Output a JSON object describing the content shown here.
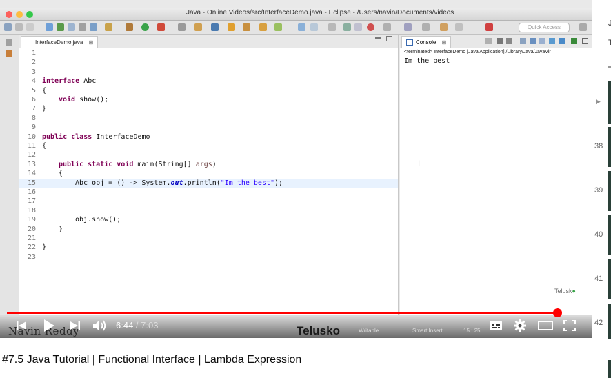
{
  "eclipse": {
    "window_title": "Java - Online Videos/src/InterfaceDemo.java - Eclipse - /Users/navin/Documents/videos",
    "quick_access": "Quick Access",
    "editor_tab": "InterfaceDemo.java",
    "editor_tab_close": "⊠",
    "line_numbers": [
      "1",
      "2",
      "3",
      "4",
      "5",
      "6",
      "7",
      "8",
      "9",
      "10",
      "11",
      "12",
      "13",
      "14",
      "15",
      "16",
      "17",
      "18",
      "19",
      "20",
      "21",
      "22",
      "23"
    ],
    "code": {
      "l4_kw": "interface",
      "l4_rest": " Abc",
      "l5": "{",
      "l6_kw": "void",
      "l6_rest": " show();",
      "l7": "}",
      "l10_kw": "public class",
      "l10_rest": " InterfaceDemo",
      "l11": "{",
      "l13_kw": "public static void",
      "l13_rest": " main(String[] ",
      "l13_param": "args",
      "l13_end": ")",
      "l14": "{",
      "l15_pre": "Abc obj = () -> System.",
      "l15_field": "out",
      "l15_mid": ".println(",
      "l15_str": "\"Im the best\"",
      "l15_end": ");",
      "l19": "obj.show();",
      "l20": "}",
      "l22": "}"
    },
    "console_tab": "Console",
    "console_tab_close": "⊠",
    "console_terminated": "<terminated> InterfaceDemo [Java Application] /Library/Java/JavaVir",
    "console_output": "Im the best",
    "status": {
      "writable": "Writable",
      "insert_mode": "Smart Insert",
      "position": "15 : 25"
    },
    "watermark_name": "Navin Reddy",
    "watermark_brand": "Telusko",
    "logo": "Telusk"
  },
  "player": {
    "time_current": "6:44",
    "time_separator": " / ",
    "time_total": "7:03",
    "progress": 0.955,
    "icons": {
      "prev": "skip-previous-icon",
      "play": "play-icon",
      "next": "skip-next-icon",
      "volume": "volume-icon",
      "subtitles": "subtitles-icon",
      "settings": "settings-gear-icon",
      "theater": "theater-mode-icon",
      "fullscreen": "fullscreen-icon"
    },
    "accent": "#ff0000"
  },
  "video_title": "#7.5 Java Tutorial | Functional Interface | Lambda Expression",
  "sidebar": {
    "top_letters": [
      "J",
      "T"
    ],
    "numbers": [
      "38",
      "39",
      "40",
      "41",
      "42"
    ]
  }
}
